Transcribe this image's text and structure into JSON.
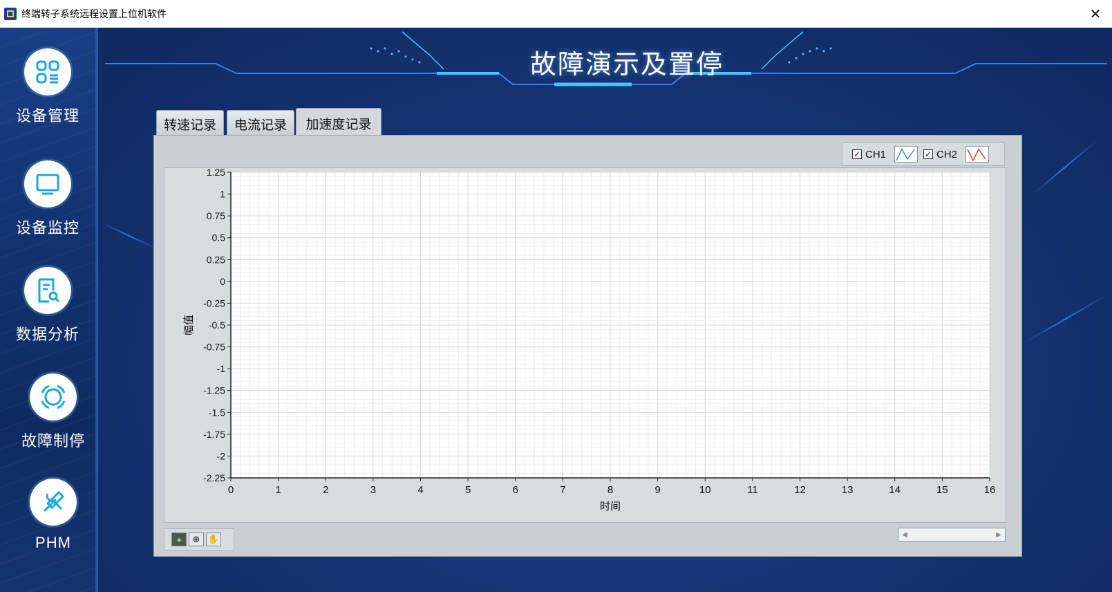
{
  "window": {
    "title": "终端转子系统远程设置上位机软件",
    "close_label": "✕"
  },
  "sidebar": {
    "items": [
      {
        "label": "设备管理",
        "icon": "grid-icon"
      },
      {
        "label": "设备监控",
        "icon": "monitor-icon"
      },
      {
        "label": "数据分析",
        "icon": "document-search-icon"
      },
      {
        "label": "故障制停",
        "icon": "target-ring-icon"
      },
      {
        "label": "PHM",
        "icon": "wrench-screwdriver-icon"
      }
    ]
  },
  "header": {
    "title": "故障演示及置停"
  },
  "tabs": [
    {
      "label": "转速记录",
      "active": false
    },
    {
      "label": "电流记录",
      "active": false
    },
    {
      "label": "加速度记录",
      "active": true
    }
  ],
  "legend": [
    {
      "label": "CH1",
      "checked": true,
      "color": "#3a8fd6"
    },
    {
      "label": "CH2",
      "checked": true,
      "color": "#e03a3a"
    }
  ],
  "chart_data": {
    "type": "line",
    "xlabel": "时间",
    "ylabel": "幅值",
    "xlim": [
      0,
      16
    ],
    "ylim": [
      -2.25,
      1.25
    ],
    "x_ticks": [
      "0",
      "1",
      "2",
      "3",
      "4",
      "5",
      "6",
      "7",
      "8",
      "9",
      "10",
      "11",
      "12",
      "13",
      "14",
      "15",
      "16"
    ],
    "y_ticks": [
      "1.25",
      "1",
      "0.75",
      "0.5",
      "0.25",
      "0",
      "-0.25",
      "-0.5",
      "-0.75",
      "-1",
      "-1.25",
      "-1.5",
      "-1.75",
      "-2",
      "-2.25"
    ],
    "series": [
      {
        "name": "CH1",
        "values": []
      },
      {
        "name": "CH2",
        "values": []
      }
    ],
    "grid": true
  },
  "toolbar": {
    "tools": [
      "cursor-icon",
      "zoom-icon",
      "pan-hand-icon"
    ]
  },
  "colors": {
    "accent": "#1b3f8c",
    "panel": "#c9cfd3",
    "plot_bg": "#ffffff"
  }
}
